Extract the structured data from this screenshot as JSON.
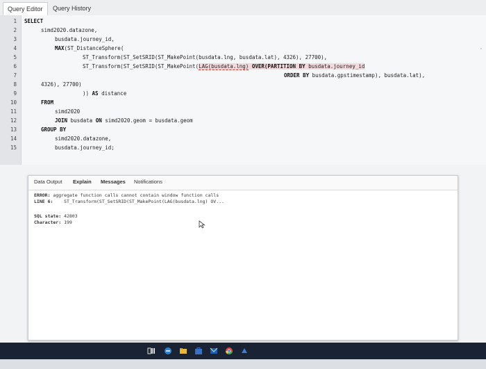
{
  "editor_tabs": {
    "query_editor": "Query Editor",
    "query_history": "Query History"
  },
  "line_numbers": [
    "1",
    "2",
    "3",
    "4",
    "5",
    "6",
    "7",
    "8",
    "9",
    "10",
    "11",
    "12",
    "13",
    "14",
    "15"
  ],
  "code": {
    "l1": "SELECT",
    "l2": "simd2020.datazone,",
    "l3": "busdata.journey_id,",
    "l4a": "MAX",
    "l4b": "(ST_DistanceSphere(",
    "l5": "ST_Transform(ST_SetSRID(ST_MakePoint(busdata.lng, busdata.lat), 4326), 27700),",
    "l6a": "ST_Transform(ST_SetSRID(ST_MakePoint(",
    "l6b": "LAG(busdata.lng)",
    "l6c": " OVER(PARTITION BY",
    "l6d": " busdata.journey_id",
    "l7a": "ORDER BY",
    "l7b": " busdata.gpstimestamp), busdata.lat),",
    "l8": "4326), 27700)",
    "l9a": ")) ",
    "l9b": "AS",
    "l9c": " distance",
    "l10": "FROM",
    "l11": "simd2020",
    "l12a": "JOIN",
    "l12b": " busdata ",
    "l12c": "ON",
    "l12d": " simd2020.geom = busdata.geom",
    "l13": "GROUP BY",
    "l14": "simd2020.datazone,",
    "l15": "busdata.journey_id;"
  },
  "output_tabs": {
    "data_output": "Data Output",
    "explain": "Explain",
    "messages": "Messages",
    "notifications": "Notifications"
  },
  "messages": {
    "error_label": "ERROR:",
    "error_text": "aggregate function calls cannot contain window function calls",
    "line_label": "LINE 6:",
    "line_text": "ST_Transform(ST_SetSRID(ST_MakePoint(LAG(busdata.lng) OV...",
    "sqlstate_label": "SQL state:",
    "sqlstate_value": "42803",
    "character_label": "Character:",
    "character_value": "199"
  },
  "colors": {
    "highlight": "#f3d9dc",
    "taskbar": "#1a2333"
  }
}
